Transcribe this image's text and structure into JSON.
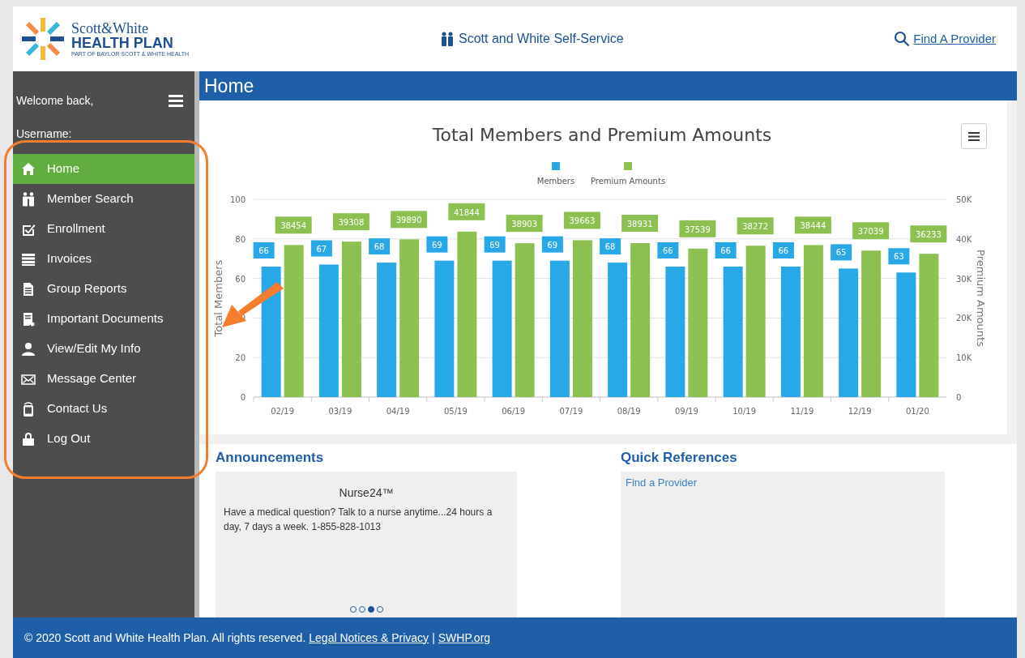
{
  "header": {
    "logo_line1": "Scott&White",
    "logo_line2": "HEALTH PLAN",
    "logo_tagline": "PART OF BAYLOR SCOTT & WHITE HEALTH",
    "site_title": "Scott and White Self-Service",
    "find_provider": "Find A Provider"
  },
  "sidebar": {
    "welcome": "Welcome back,",
    "username_label": "Username:",
    "items": [
      {
        "label": "Home",
        "selected": true
      },
      {
        "label": "Member Search",
        "selected": false
      },
      {
        "label": "Enrollment",
        "selected": false
      },
      {
        "label": "Invoices",
        "selected": false
      },
      {
        "label": "Group Reports",
        "selected": false
      },
      {
        "label": "Important Documents",
        "selected": false
      },
      {
        "label": "View/Edit My Info",
        "selected": false
      },
      {
        "label": "Message Center",
        "selected": false
      },
      {
        "label": "Contact Us",
        "selected": false
      },
      {
        "label": "Log Out",
        "selected": false
      }
    ]
  },
  "page_title": "Home",
  "chart": {
    "members": {
      "chart_data": {
        "type": "bar",
        "title": "Total Members and Premium Amounts",
        "categories": [
          "02/19",
          "03/19",
          "04/19",
          "05/19",
          "06/19",
          "07/19",
          "08/19",
          "09/19",
          "10/19",
          "11/19",
          "12/19",
          "01/20"
        ],
        "series": [
          {
            "name": "Members",
            "color": "#29a8e8",
            "values": [
              66,
              67,
              68,
              69,
              69,
              69,
              68,
              66,
              66,
              66,
              65,
              63
            ]
          }
        ],
        "ylabel": "Total Members",
        "ylim": [
          0,
          100
        ],
        "yticks": [
          0,
          20,
          40,
          60,
          80,
          100
        ],
        "grid": true,
        "data_labels": true
      }
    },
    "premium": {
      "chart_data": {
        "type": "bar",
        "series": [
          {
            "name": "Premium Amounts",
            "color": "#8cc152",
            "values": [
              38454,
              39308,
              39890,
              41844,
              38903,
              39663,
              38931,
              37539,
              38272,
              38444,
              37039,
              36233
            ]
          }
        ],
        "ylabel": "Premium Amounts",
        "ylim": [
          0,
          50000
        ],
        "yticks": [
          {
            "value": 0,
            "label": "0"
          },
          {
            "value": 10000,
            "label": "10K"
          },
          {
            "value": 20000,
            "label": "20K"
          },
          {
            "value": 30000,
            "label": "30K"
          },
          {
            "value": 40000,
            "label": "40K"
          },
          {
            "value": 50000,
            "label": "50K"
          }
        ],
        "data_labels": true
      }
    }
  },
  "announcements": {
    "heading": "Announcements",
    "title": "Nurse24™",
    "body": "Have a medical question? Talk to a nurse anytime...24 hours a day, 7 days a week. 1-855-828-1013",
    "dots": [
      {
        "selected": false
      },
      {
        "selected": false
      },
      {
        "selected": true
      },
      {
        "selected": false
      }
    ]
  },
  "quick_references": {
    "heading": "Quick References",
    "links": [
      "Find a Provider"
    ]
  },
  "footer": {
    "text": "© 2020 Scott and White Health Plan. All rights reserved.",
    "links": [
      "Legal Notices & Privacy",
      "SWHP.org"
    ],
    "separator": "|"
  }
}
